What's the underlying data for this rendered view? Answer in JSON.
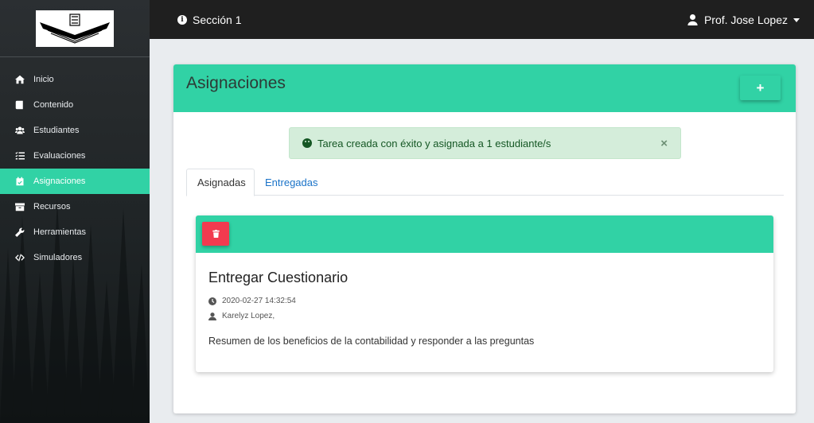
{
  "topbar": {
    "section": "Sección 1",
    "user": "Prof. Jose Lopez"
  },
  "sidebar": {
    "items": [
      {
        "label": "Inicio",
        "icon": "home-icon"
      },
      {
        "label": "Contenido",
        "icon": "book-icon"
      },
      {
        "label": "Estudiantes",
        "icon": "users-icon"
      },
      {
        "label": "Evaluaciones",
        "icon": "list-check-icon"
      },
      {
        "label": "Asignaciones",
        "icon": "calendar-check-icon",
        "active": true
      },
      {
        "label": "Recursos",
        "icon": "archive-icon"
      },
      {
        "label": "Herramientas",
        "icon": "wrench-icon"
      },
      {
        "label": "Simuladores",
        "icon": "code-icon"
      }
    ]
  },
  "main": {
    "title": "Asignaciones",
    "add_label": "+",
    "alert": {
      "text": "Tarea creada con éxito y asignada a 1 estudiante/s",
      "close": "×"
    },
    "tabs": [
      {
        "label": "Asignadas",
        "active": true
      },
      {
        "label": "Entregadas",
        "active": false
      }
    ],
    "task": {
      "title": "Entregar Cuestionario",
      "date": "2020-02-27 14:32:54",
      "students": "Karelyz Lopez,",
      "description": "Resumen de los beneficios de la contabilidad y responder a las preguntas"
    }
  },
  "colors": {
    "accent": "#31d2a5",
    "danger": "#f23a4f",
    "topbar": "#1f1f1f",
    "alert_bg": "#d4edda",
    "link": "#1a73c8"
  }
}
